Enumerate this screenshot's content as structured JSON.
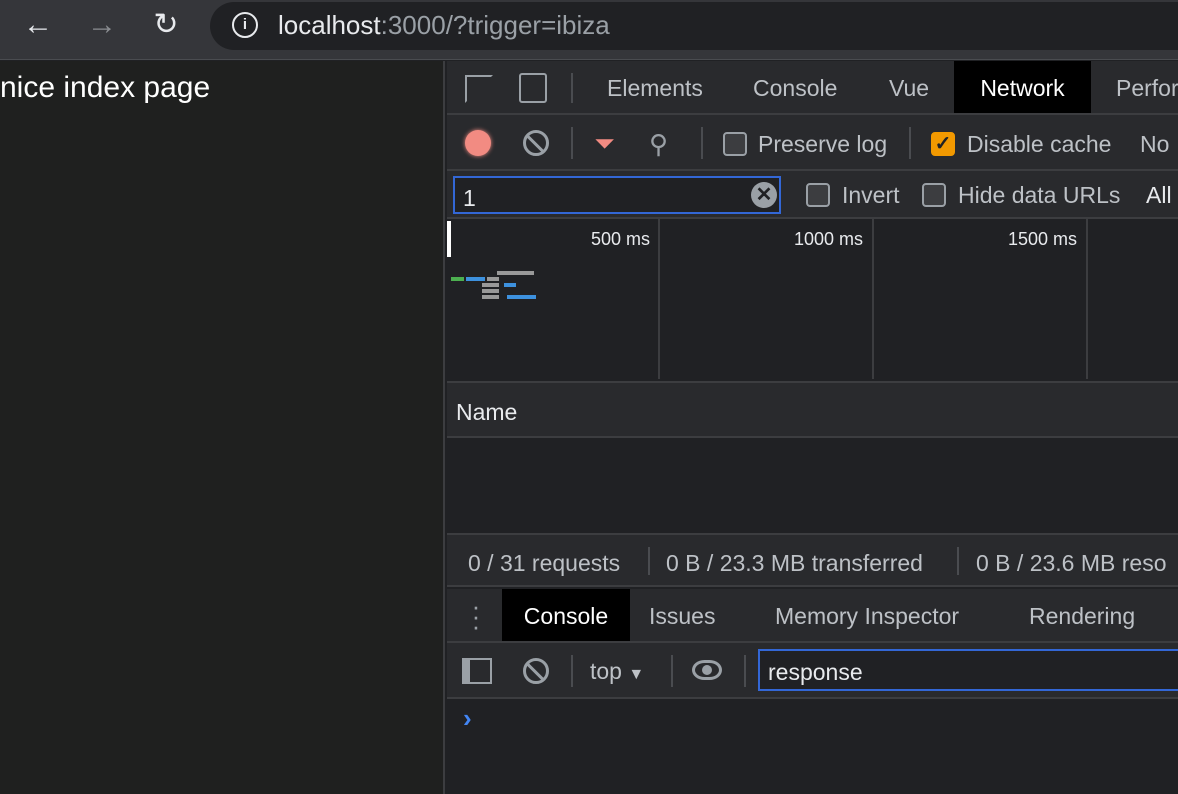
{
  "browser": {
    "back_icon": "arrow-left",
    "forward_icon": "arrow-right",
    "reload_icon": "reload",
    "url_host": "localhost",
    "url_rest": ":3000/?trigger=ibiza"
  },
  "page": {
    "text": "nice index page"
  },
  "devtools": {
    "tabs": [
      {
        "label": "Elements"
      },
      {
        "label": "Console"
      },
      {
        "label": "Vue"
      },
      {
        "label": "Network",
        "selected": true
      },
      {
        "label": "Perfor"
      }
    ],
    "network": {
      "preserve_log": {
        "label": "Preserve log",
        "checked": false
      },
      "disable_cache": {
        "label": "Disable cache",
        "checked": true
      },
      "throttle": "No",
      "filter_value": "1",
      "invert": {
        "label": "Invert",
        "checked": false
      },
      "hide_data_urls": {
        "label": "Hide data URLs",
        "checked": false
      },
      "type_all": "All",
      "ticks": [
        "500 ms",
        "1000 ms",
        "1500 ms"
      ],
      "name_header": "Name",
      "status": {
        "requests": "0 / 31 requests",
        "transferred": "0 B / 23.3 MB transferred",
        "resources": "0 B / 23.6 MB reso"
      }
    },
    "drawer": {
      "tabs": [
        {
          "label": "Console",
          "selected": true
        },
        {
          "label": "Issues"
        },
        {
          "label": "Memory Inspector"
        },
        {
          "label": "Rendering"
        }
      ],
      "context": "top",
      "filter_value": "response",
      "prompt": "›"
    },
    "colors": {
      "record": "#f28b82",
      "filter": "#f28b82",
      "checkbox": "#f29900",
      "selected_tab": "#000000",
      "focus": "#3367d6"
    }
  }
}
